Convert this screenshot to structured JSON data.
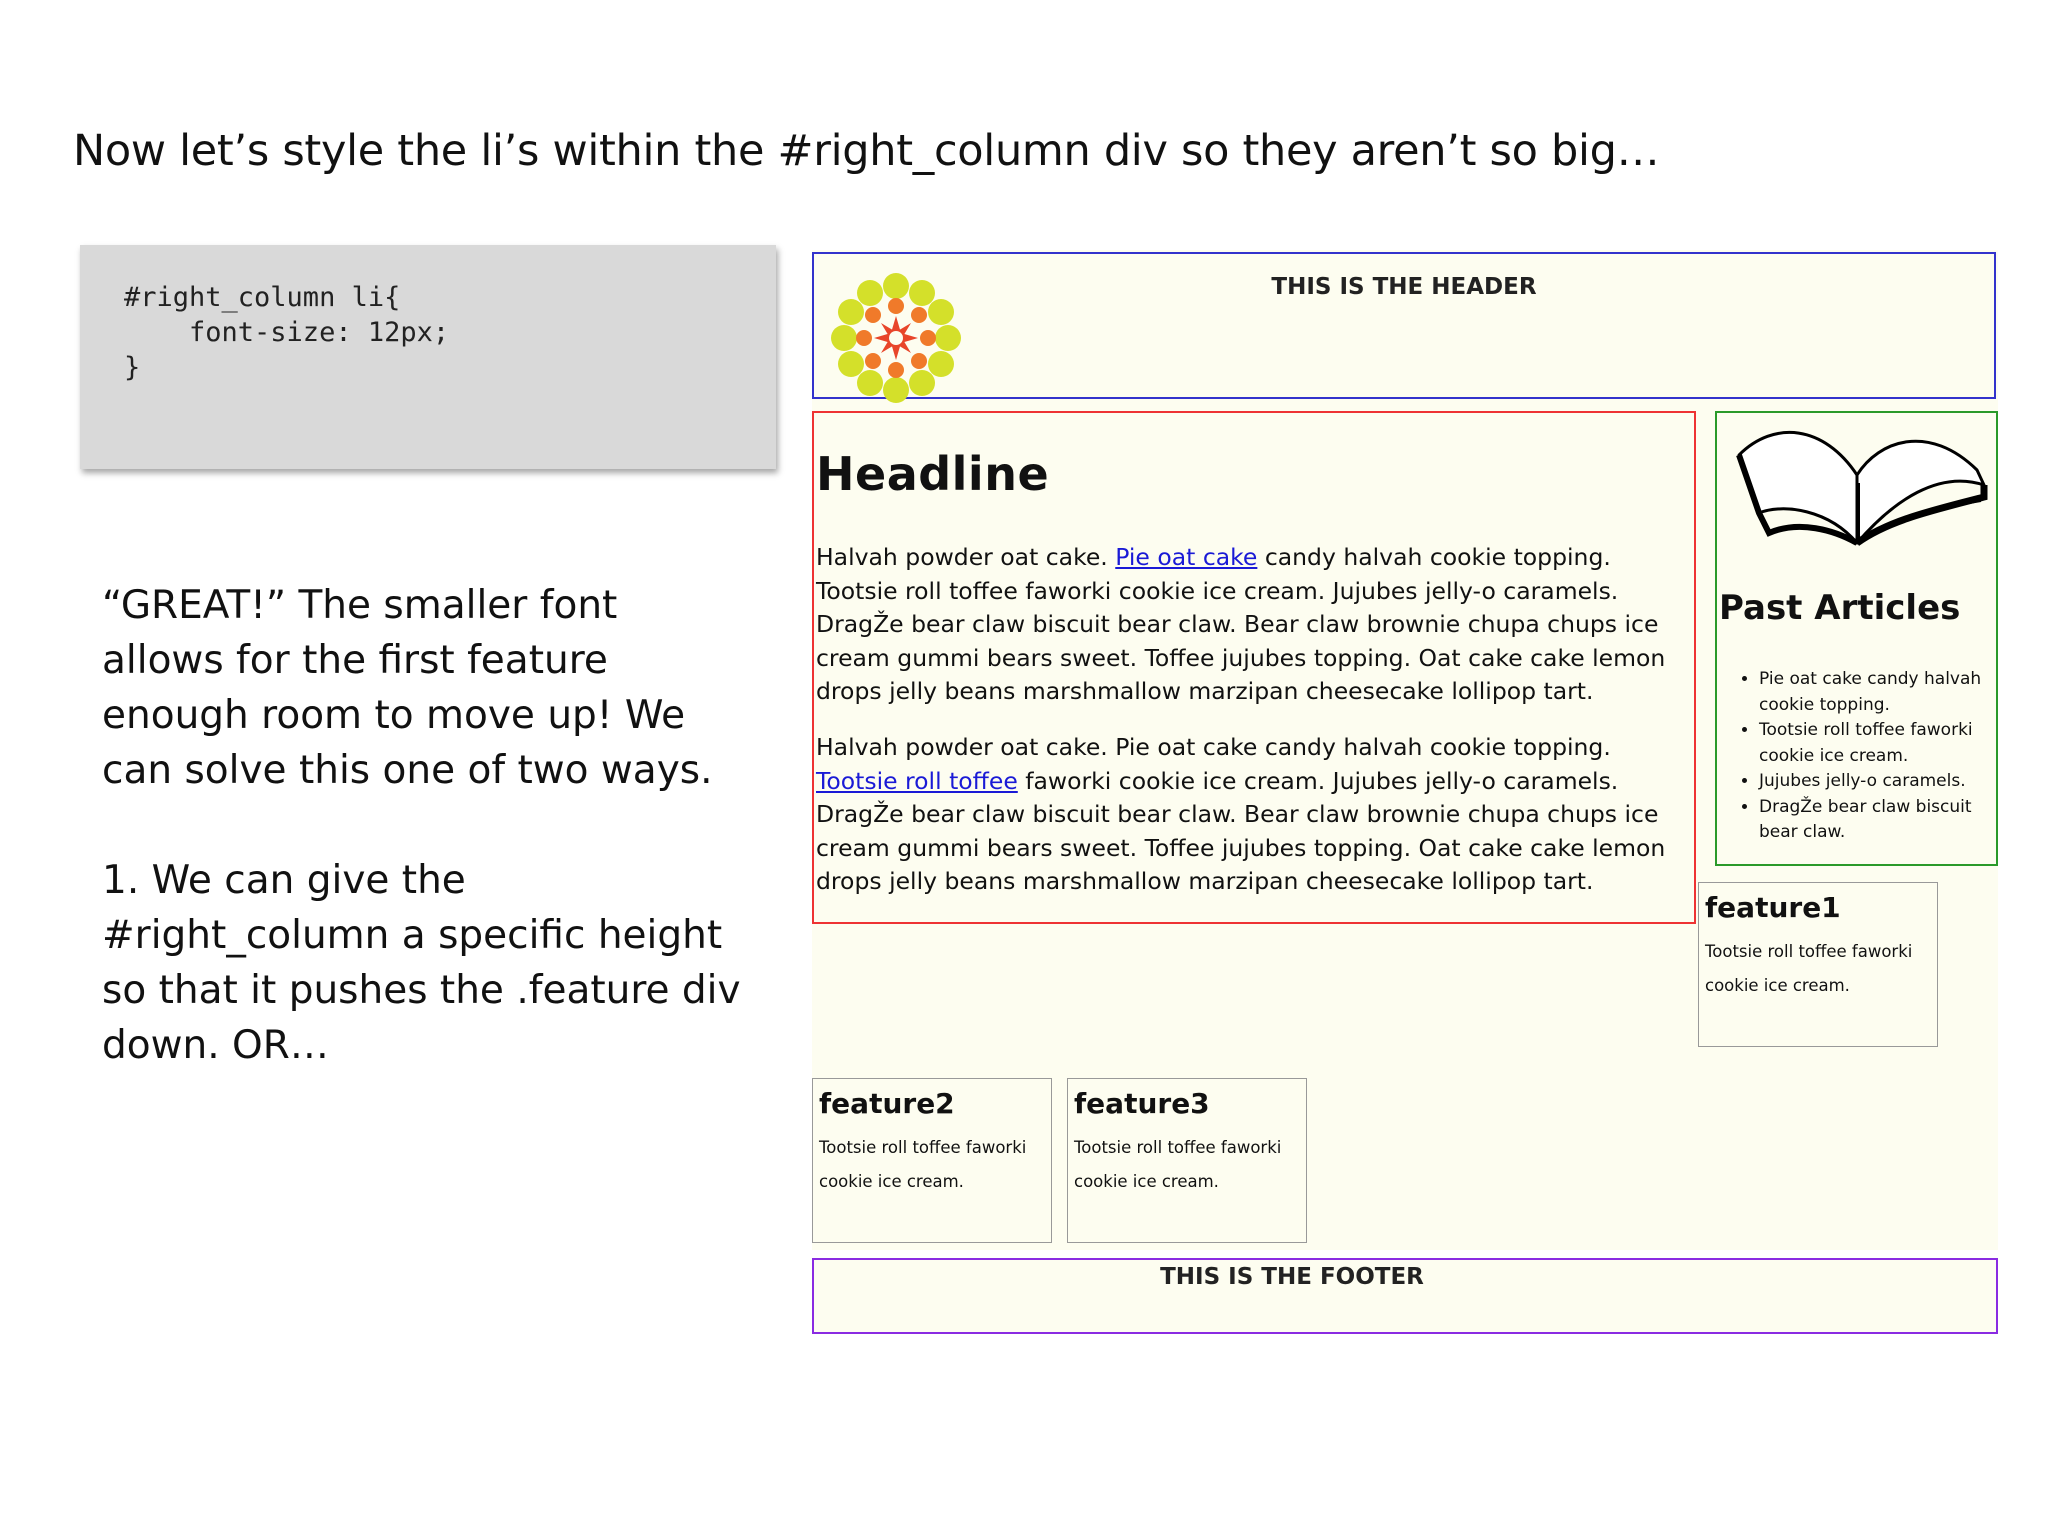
{
  "slide": {
    "title": "Now let’s style the li’s within the #right_column div so they aren’t so big…",
    "code": "#right_column li{\n    font-size: 12px;\n}",
    "body_paragraphs": [
      "“GREAT!” The smaller font allows for the first feature enough room to move up! We can solve this one of two ways.",
      "1. We can give the #right_column a specific height so that it pushes the .feature div down. OR…"
    ]
  },
  "mockup": {
    "header_title": "THIS IS THE HEADER",
    "headline": "Headline",
    "paragraph1": {
      "before": "Halvah powder oat cake. ",
      "link": "Pie oat cake",
      "after": " candy halvah cookie topping. Tootsie roll toffee faworki cookie ice cream. Jujubes jelly-o caramels. DragŽe bear claw biscuit bear claw. Bear claw brownie chupa chups ice cream gummi bears sweet. Toffee jujubes topping. Oat cake cake lemon drops jelly beans marshmallow marzipan cheesecake lollipop tart."
    },
    "paragraph2": {
      "before": "Halvah powder oat cake. Pie oat cake candy halvah cookie topping. ",
      "link": "Tootsie roll toffee",
      "after": " faworki cookie ice cream. Jujubes jelly-o caramels. DragŽe bear claw biscuit bear claw. Bear claw brownie chupa chups ice cream gummi bears sweet. Toffee jujubes topping. Oat cake cake lemon drops jelly beans marshmallow marzipan cheesecake lollipop tart."
    },
    "past_articles": {
      "title": "Past Articles",
      "items": [
        "Pie oat cake candy halvah cookie topping.",
        "Tootsie roll toffee faworki cookie ice cream.",
        "Jujubes jelly-o caramels.",
        "DragŽe bear claw biscuit bear claw."
      ]
    },
    "features": [
      {
        "title": "feature1",
        "text": "Tootsie roll toffee faworki cookie ice cream."
      },
      {
        "title": "feature2",
        "text": "Tootsie roll toffee faworki cookie ice cream."
      },
      {
        "title": "feature3",
        "text": "Tootsie roll toffee faworki cookie ice cream."
      }
    ],
    "footer_title": "THIS IS THE FOOTER"
  },
  "colors": {
    "header_border": "#3333cc",
    "main_border": "#ee3333",
    "right_column_border": "#2a9a2a",
    "footer_border": "#8a2be2",
    "page_background": "#fdfdf0",
    "link": "#1a1ad6"
  },
  "icons": [
    "flower-logo-icon",
    "open-book-icon"
  ]
}
